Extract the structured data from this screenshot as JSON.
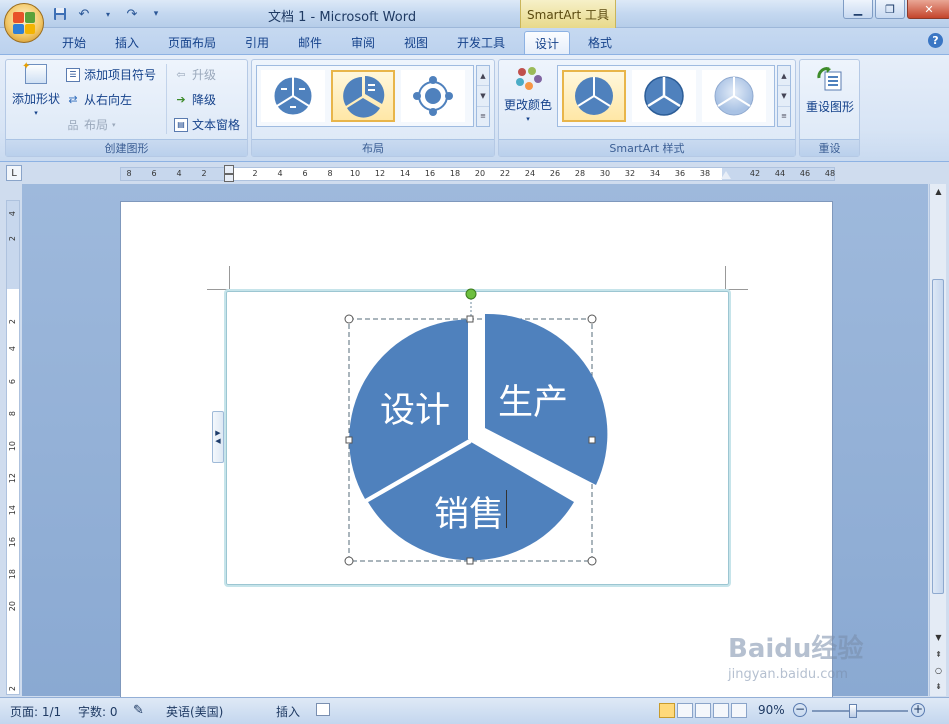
{
  "window": {
    "doc_title": "文档 1 - Microsoft Word",
    "context_tools": "SmartArt 工具",
    "controls": [
      "minimize-icon",
      "restore-icon",
      "close-icon"
    ]
  },
  "quick_access": [
    "save-icon",
    "undo-icon",
    "redo-icon",
    "customize-icon"
  ],
  "tabs": [
    {
      "label": "开始"
    },
    {
      "label": "插入"
    },
    {
      "label": "页面布局"
    },
    {
      "label": "引用"
    },
    {
      "label": "邮件"
    },
    {
      "label": "审阅"
    },
    {
      "label": "视图"
    },
    {
      "label": "开发工具"
    },
    {
      "label": "设计",
      "active": true
    },
    {
      "label": "格式"
    }
  ],
  "ribbon": {
    "create_group": {
      "label": "创建图形",
      "add_shape": "添加形状",
      "add_bullet": "添加项目符号",
      "right_to_left": "从右向左",
      "layout": "布局",
      "promote": "升级",
      "demote": "降级",
      "text_pane": "文本窗格"
    },
    "layout_group": {
      "label": "布局"
    },
    "styles_group": {
      "label": "SmartArt 样式",
      "change_colors": "更改颜色"
    },
    "reset_group": {
      "label": "重设",
      "reset_graphic": "重设图形"
    }
  },
  "ruler": {
    "h_numbers": [
      "8",
      "6",
      "4",
      "2",
      "2",
      "4",
      "6",
      "8",
      "10",
      "12",
      "14",
      "16",
      "18",
      "20",
      "22",
      "24",
      "26",
      "28",
      "30",
      "32",
      "34",
      "36",
      "38",
      "42",
      "44",
      "46",
      "48"
    ],
    "v_numbers": [
      "4",
      "2",
      "2",
      "4",
      "6",
      "8",
      "10",
      "12",
      "14",
      "16",
      "18",
      "20",
      "2"
    ]
  },
  "document": {
    "smartart_segments": [
      "设计",
      "生产",
      "销售"
    ],
    "segment_color": "#4f81bd"
  },
  "status": {
    "page": "页面: 1/1",
    "words": "字数: 0",
    "language": "英语(美国)",
    "mode": "插入",
    "zoom": "90%"
  },
  "watermark": {
    "text": "Baidu经验",
    "url": "jingyan.baidu.com"
  },
  "colors": {
    "accent": "#4f81bd",
    "ribbon_bg": "#dbe7f6",
    "title_bar": "#c4d8f0"
  }
}
